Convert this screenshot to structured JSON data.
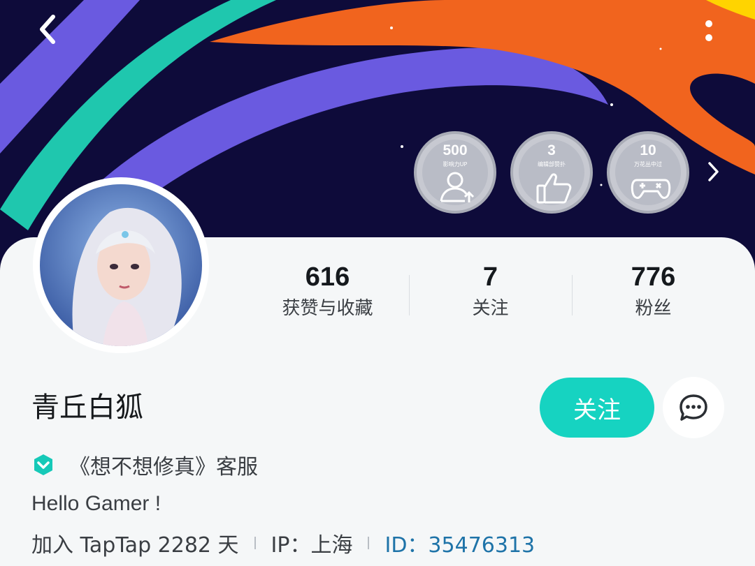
{
  "header": {
    "back_icon": "chevron-left-icon",
    "more_icon": "more-vertical-icon"
  },
  "badges": [
    {
      "number": "500",
      "caption": "影响力UP",
      "icon": "user-up-icon"
    },
    {
      "number": "3",
      "caption": "编辑部赞扑",
      "icon": "thumbs-up-icon"
    },
    {
      "number": "10",
      "caption": "万花丛中过",
      "icon": "gamepad-icon"
    }
  ],
  "stats": [
    {
      "value": "616",
      "label": "获赞与收藏"
    },
    {
      "value": "7",
      "label": "关注"
    },
    {
      "value": "776",
      "label": "粉丝"
    }
  ],
  "profile": {
    "username": "青丘白狐",
    "follow_label": "关注",
    "verified_text": "《想不想修真》客服",
    "bio": "Hello Gamer !",
    "joined": "加入 TapTap 2282 天",
    "ip": "IP：上海",
    "id": "ID：35476313"
  },
  "colors": {
    "accent": "#16d3c1",
    "link": "#1e73a8",
    "banner_bg": "#0e0b3a"
  }
}
